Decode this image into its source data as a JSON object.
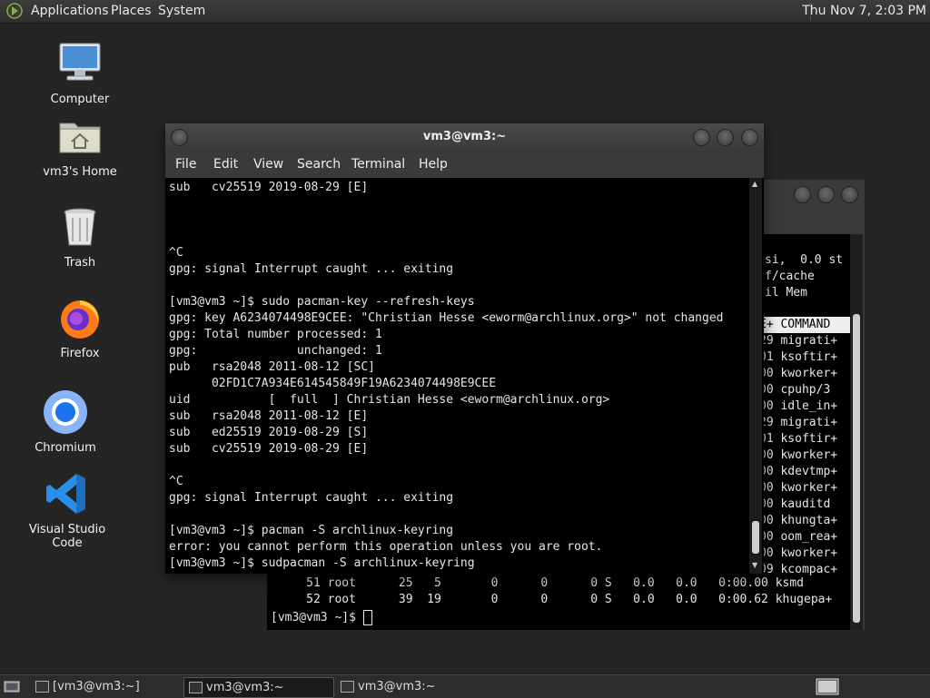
{
  "top_panel": {
    "menus": [
      "Applications",
      "Places",
      "System"
    ],
    "clock": "Thu Nov 7, 2:03 PM"
  },
  "desktop_icons": [
    {
      "label": "Computer",
      "icon": "computer-icon"
    },
    {
      "label": "vm3's Home",
      "icon": "home-folder-icon"
    },
    {
      "label": "Trash",
      "icon": "trash-icon"
    },
    {
      "label": "Firefox",
      "icon": "firefox-icon"
    },
    {
      "label": "Chromium",
      "icon": "chromium-icon"
    },
    {
      "label": "Visual Studio Code",
      "icon": "vscode-icon"
    }
  ],
  "front_window": {
    "title": "vm3@vm3:~",
    "menu": [
      "File",
      "Edit",
      "View",
      "Search",
      "Terminal",
      "Help"
    ],
    "lines": [
      "sub   cv25519 2019-08-29 [E]",
      "",
      "",
      "",
      "^C",
      "gpg: signal Interrupt caught ... exiting",
      "",
      "[vm3@vm3 ~]$ sudo pacman-key --refresh-keys",
      "gpg: key A6234074498E9CEE: \"Christian Hesse <eworm@archlinux.org>\" not changed",
      "gpg: Total number processed: 1",
      "gpg:              unchanged: 1",
      "pub   rsa2048 2011-08-12 [SC]",
      "      02FD1C7A934E614545849F19A6234074498E9CEE",
      "uid           [  full  ] Christian Hesse <eworm@archlinux.org>",
      "sub   rsa2048 2011-08-12 [E]",
      "sub   ed25519 2019-08-29 [S]",
      "sub   cv25519 2019-08-29 [E]",
      "",
      "^C",
      "gpg: signal Interrupt caught ... exiting",
      "",
      "[vm3@vm3 ~]$ pacman -S archlinux-keyring",
      "error: you cannot perform this operation unless you are root.",
      "[vm3@vm3 ~]$ sudpacman -S archlinux-keyring"
    ]
  },
  "back_window": {
    "header_lines": [
      "si,  0.0 st",
      "f/cache",
      "il Mem"
    ],
    "column_header": "E+ COMMAND",
    "right_column": [
      "29 migrati+",
      "01 ksoftir+",
      "00 kworker+",
      "00 cpuhp/3",
      "00 idle_in+",
      "29 migrati+",
      "01 ksoftir+",
      "00 kworker+",
      "00 kdevtmp+",
      "00 kworker+",
      "00 kauditd",
      "00 khungta+",
      "00 oom_rea+",
      "00 kworker+",
      "09 kcompac+"
    ],
    "bottom_rows": [
      "     51 root      25   5       0      0      0 S   0.0   0.0   0:00.00 ksmd",
      "     52 root      39  19       0      0      0 S   0.0   0.0   0:00.62 khugepa+"
    ],
    "prompt": "[vm3@vm3 ~]$ "
  },
  "taskbar": {
    "items": [
      "[vm3@vm3:~]",
      "vm3@vm3:~",
      "vm3@vm3:~"
    ]
  }
}
